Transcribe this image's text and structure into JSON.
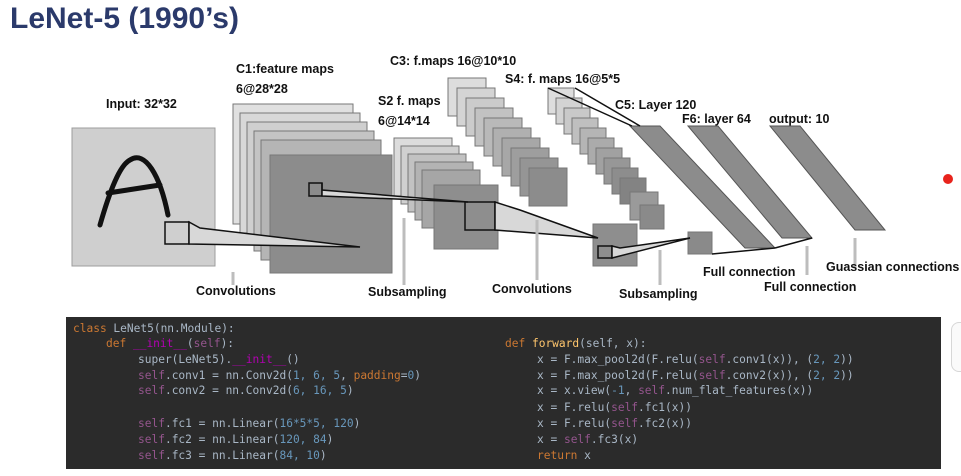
{
  "slide": {
    "title": "LeNet-5 (1990’s)"
  },
  "diagram_labels": {
    "input": "Input: 32*32",
    "c1_line1": "C1:feature maps",
    "c1_line2": "6@28*28",
    "s2_line1": "S2 f. maps",
    "s2_line2": "6@14*14",
    "c3": "C3: f.maps 16@10*10",
    "s4": "S4: f. maps 16@5*5",
    "c5": "C5: Layer 120",
    "f6": "F6: layer 64",
    "output": "output: 10",
    "op_convolutions_1": "Convolutions",
    "op_subsampling_1": "Subsampling",
    "op_convolutions_2": "Convolutions",
    "op_subsampling_2": "Subsampling",
    "op_full_connection_1": "Full connection",
    "op_full_connection_2": "Full connection",
    "op_gaussian": "Guassian connections"
  },
  "colors": {
    "title": "#2b3a6b",
    "code_background": "#2b2b2b",
    "code_text": "#a9b7c6",
    "keyword": "#cc7832",
    "self": "#94558d",
    "function_name": "#ffc66d",
    "number": "#6897bb",
    "dunder": "#b200b2",
    "red_dot": "#e8231c"
  },
  "code": {
    "class_kw": "class",
    "class_decl": " LeNet5(nn.Module):",
    "def_kw": "def",
    "init_name": "__init__",
    "init_open": "(",
    "self": "self",
    "init_close": "):",
    "super_pre": "super(LeNet5).",
    "super_post": "()",
    "conv1_attr": ".conv1 = nn.Conv2d(",
    "conv1_args": "1, 6, 5",
    "comma_sp": ", ",
    "padding_kw": "padding",
    "eq": "=",
    "zero": "0",
    "close_paren": ")",
    "conv2_attr": ".conv2 = nn.Conv2d(",
    "conv2_args": "6, 16, 5",
    "fc1_attr": ".fc1 = nn.Linear(",
    "fc1_args": "16*5*5, 120",
    "fc2_attr": ".fc2 = nn.Linear(",
    "fc2_args": "120, 84",
    "fc3_attr": ".fc3 = nn.Linear(",
    "fc3_args": "84, 10",
    "forward_name": "forward",
    "forward_params": "(self, x):",
    "fwd1_pre": "x = F.max_pool2d(F.relu(",
    "fwd1_mid": ".conv1(x)), (",
    "two_two": "2, 2",
    "fwd_end": "))",
    "fwd2_mid": ".conv2(x)), (",
    "fwd3_pre": "x = x.view(",
    "neg_one": "-1",
    "fwd3_mid": ", ",
    "fwd3_post": ".num_flat_features(x))",
    "fwd4_pre": "x = F.relu(",
    "fwd4_post": ".fc1(x))",
    "fwd5_post": ".fc2(x))",
    "fwd6_pre": "x = ",
    "fwd6_post": ".fc3(x)",
    "return_kw": "return",
    "return_val": " x"
  }
}
